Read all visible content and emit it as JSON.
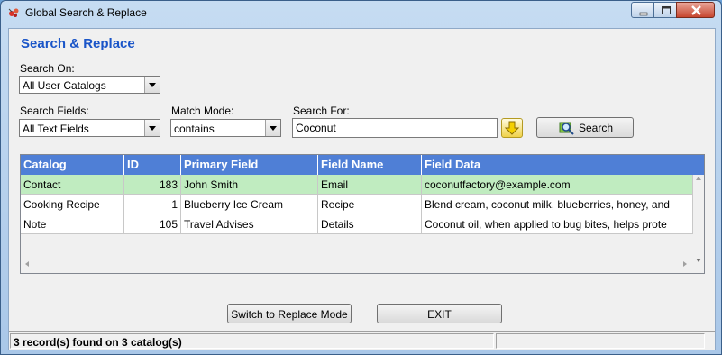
{
  "window": {
    "title": "Global Search & Replace"
  },
  "heading": "Search & Replace",
  "search_on": {
    "label": "Search On:",
    "value": "All User Catalogs"
  },
  "search_fields": {
    "label": "Search Fields:",
    "value": "All Text Fields"
  },
  "match_mode": {
    "label": "Match Mode:",
    "value": "contains"
  },
  "search_for": {
    "label": "Search For:",
    "value": "Coconut"
  },
  "search_button": {
    "label": "Search"
  },
  "grid": {
    "columns": [
      "Catalog",
      "ID",
      "Primary Field",
      "Field Name",
      "Field Data"
    ],
    "rows": [
      {
        "catalog": "Contact",
        "id": "183",
        "primary": "John Smith",
        "field_name": "Email",
        "field_data": "coconutfactory@example.com"
      },
      {
        "catalog": "Cooking Recipe",
        "id": "1",
        "primary": "Blueberry Ice Cream",
        "field_name": "Recipe",
        "field_data": "Blend cream, coconut milk, blueberries, honey, and"
      },
      {
        "catalog": "Note",
        "id": "105",
        "primary": "Travel Advises",
        "field_name": "Details",
        "field_data": "Coconut oil, when applied to bug bites, helps prote"
      }
    ],
    "selected_row_color": "#c0ecc0",
    "header_color": "#4f7fd6"
  },
  "buttons": {
    "replace_mode": "Switch to Replace Mode",
    "exit": "EXIT"
  },
  "status": {
    "message": "3 record(s) found on 3 catalog(s)",
    "secondary": ""
  },
  "icons": [
    "app-icon",
    "minimize-icon",
    "maximize-icon",
    "close-icon",
    "dropdown-arrow-icon",
    "down-arrow-icon",
    "search-icon"
  ]
}
